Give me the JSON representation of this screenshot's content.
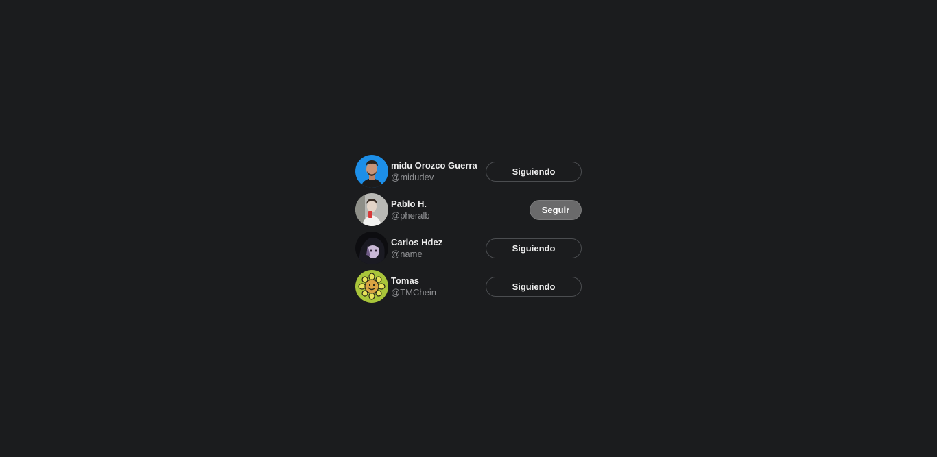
{
  "users": [
    {
      "name": "midu Orozco Guerra",
      "handle": "@midudev",
      "button_label": "Siguiendo",
      "following": true,
      "avatar_colors": {
        "bg": "#1d8fe8",
        "skin": "#c79478",
        "hair": "#2a241f",
        "shirt": "#1c1c1c"
      }
    },
    {
      "name": "Pablo H.",
      "handle": "@pheralb",
      "button_label": "Seguir",
      "following": false,
      "avatar_colors": {
        "bg": "#b9b9b5",
        "skin": "#e3d4c7",
        "hair": "#3a2e26",
        "shirt": "#f2f2f0",
        "accent": "#d83a3a"
      }
    },
    {
      "name": "Carlos Hdez",
      "handle": "@name",
      "button_label": "Siguiendo",
      "following": true,
      "avatar_colors": {
        "bg": "#0d0d10",
        "skin": "#c9b8d6",
        "hair": "#1a1a22",
        "accent": "#6e5a86"
      }
    },
    {
      "name": "Tomas",
      "handle": "@TMChein",
      "button_label": "Siguiendo",
      "following": true,
      "avatar_colors": {
        "bg": "#a9c53a",
        "petal": "#e8e25a",
        "outline": "#2b2b1a",
        "face": "#d9a443"
      }
    }
  ],
  "icons": {
    "avatar_0": "portrait-man-blue-background",
    "avatar_1": "portrait-man-red-phone",
    "avatar_2": "anime-character-portrait",
    "avatar_3": "smiling-flower-icon"
  }
}
